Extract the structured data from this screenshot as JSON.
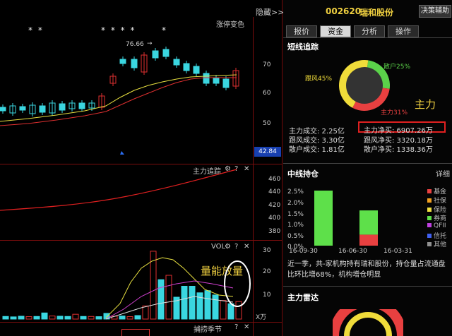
{
  "header": {
    "hide_label": "隐藏>>",
    "stock_code": "002620",
    "stock_name": "瑞和股份",
    "decision_button": "决策辅助"
  },
  "tabs": [
    {
      "label": "报价"
    },
    {
      "label": "资金"
    },
    {
      "label": "分析"
    },
    {
      "label": "操作"
    }
  ],
  "main_chart": {
    "title": "涨停变色",
    "star_groups": [
      "* *",
      "* * * *",
      "*"
    ],
    "peak_label": "76.66",
    "y_ticks": [
      "70",
      "60",
      "50"
    ],
    "current_price": "42.84"
  },
  "tracking_chart": {
    "title": "主力追踪",
    "y_ticks": [
      "460",
      "440",
      "420",
      "400",
      "380"
    ]
  },
  "vol_chart": {
    "title": "VOL",
    "annotation": "量能放量",
    "y_ticks": [
      "30",
      "20",
      "10"
    ],
    "unit": "X万",
    "bar_heights": [
      1.2,
      1.0,
      1.3,
      1.1,
      1.2,
      2.8,
      1.4,
      1.3,
      1.2,
      2.2,
      1.2,
      1.2,
      1.1,
      2.6,
      1.3,
      1.4,
      1.1,
      1.6,
      6.0,
      31.0,
      18.0,
      20.0,
      10.0,
      15.0,
      15.0,
      12.0,
      13.0,
      11.0,
      8.5,
      7.0,
      8.0
    ],
    "bar_filled": [
      true,
      true,
      true,
      false,
      true,
      true,
      false,
      true,
      true,
      false,
      true,
      false,
      true,
      true,
      false,
      true,
      false,
      true,
      false,
      false,
      true,
      false,
      true,
      true,
      true,
      true,
      true,
      true,
      false,
      true,
      false
    ]
  },
  "bottom_chart": {
    "title": "捕捞季节"
  },
  "short_term": {
    "title": "短线追踪",
    "pie": [
      {
        "name": "散户25%",
        "value": 25,
        "color": "#5bd24a"
      },
      {
        "name": "主力31%",
        "value": 31,
        "color": "#e84040"
      },
      {
        "name": "跟风45%",
        "value": 45,
        "color": "#f0dc3a"
      }
    ],
    "main_force_label": "主力",
    "stats_left": [
      "主力成交: 2.25亿",
      "跟风成交: 3.30亿",
      "散户成交: 1.81亿"
    ],
    "stats_right": [
      "主力净买: 6907.26万",
      "跟风净买: 3320.18万",
      "散户净买: 1338.36万"
    ]
  },
  "mid_term": {
    "title": "中线持仓",
    "detail_label": "详细",
    "chart_data": {
      "type": "bar",
      "categories": [
        "16-09-30",
        "16-06-30",
        "16-03-31"
      ],
      "series": [
        {
          "name": "基金",
          "values": [
            0.0,
            0.5,
            0.0
          ],
          "color": "#e84040"
        },
        {
          "name": "券商",
          "values": [
            2.5,
            1.1,
            0.0
          ],
          "color": "#5ee04a"
        }
      ],
      "legend": [
        {
          "name": "基金",
          "color": "#e84040"
        },
        {
          "name": "社保",
          "color": "#f0a020"
        },
        {
          "name": "保险",
          "color": "#f0e040"
        },
        {
          "name": "券商",
          "color": "#5ee04a"
        },
        {
          "name": "QFII",
          "color": "#c040e0"
        },
        {
          "name": "信托",
          "color": "#4060f0"
        },
        {
          "name": "其他",
          "color": "#909090"
        }
      ],
      "y_ticks": [
        "2.5%",
        "2.0%",
        "1.5%",
        "1.0%",
        "0.5%",
        "0.0%"
      ],
      "ylim": [
        0,
        2.5
      ]
    },
    "note": "近一季，共-家机构持有瑞和股份，持仓量占流通盘比环比增68%，机构增仓明显"
  },
  "radar": {
    "title": "主力雷达"
  },
  "icons": {
    "gear": "⚙",
    "help": "?",
    "close": "✕"
  }
}
